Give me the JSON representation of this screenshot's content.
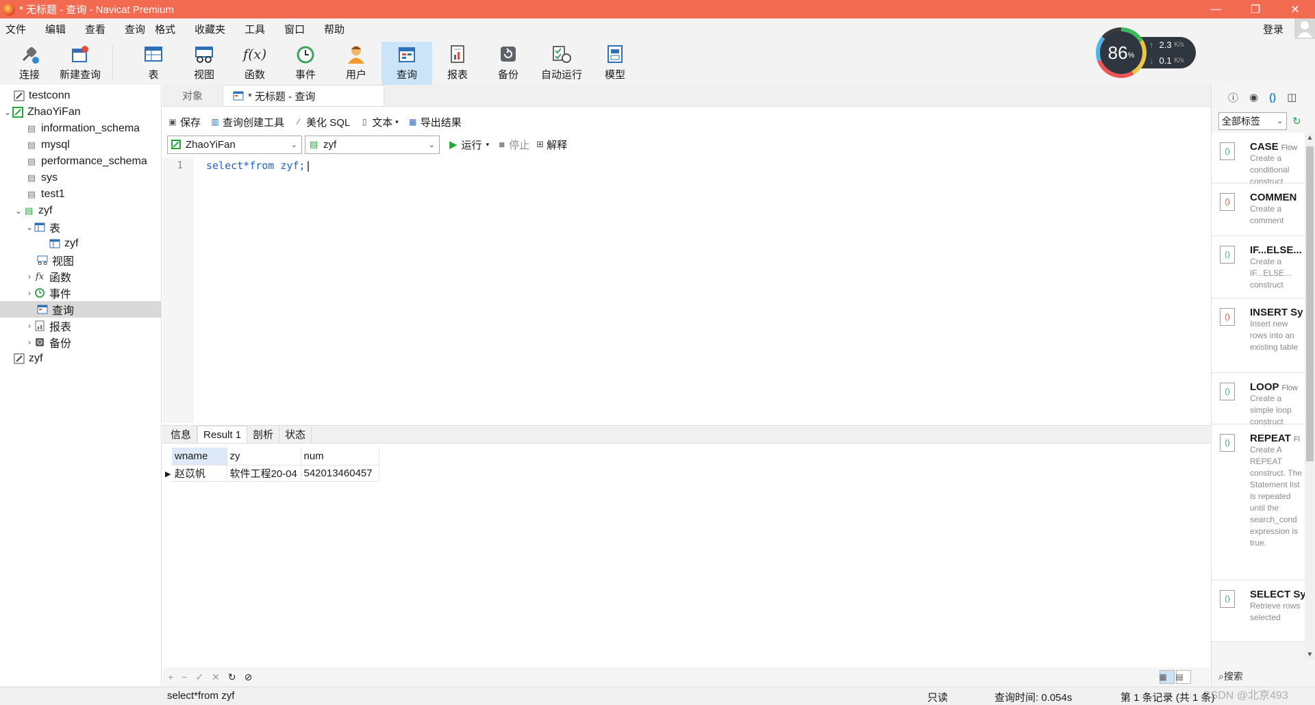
{
  "window": {
    "title": "* 无标题 - 查询 - Navicat Premium",
    "minimize": "—",
    "maximize": "❐",
    "close": "✕"
  },
  "menu": {
    "items": [
      "文件",
      "编辑",
      "查看",
      "查询",
      "格式",
      "收藏夹",
      "工具",
      "窗口",
      "帮助"
    ],
    "login": "登录"
  },
  "toolbar": {
    "connect": "连接",
    "new_query": "新建查询",
    "table": "表",
    "view": "视图",
    "function": "函数",
    "event": "事件",
    "user": "用户",
    "query": "查询",
    "report": "报表",
    "backup": "备份",
    "auto_run": "自动运行",
    "model": "模型"
  },
  "net_widget": {
    "percent": "86",
    "unit": "%",
    "up": "2.3",
    "down": "0.1",
    "rate_unit": "K/s"
  },
  "tree": {
    "items": [
      "testconn",
      "ZhaoYiFan",
      "information_schema",
      "mysql",
      "performance_schema",
      "sys",
      "test1",
      "zyf",
      "表",
      "zyf",
      "视图",
      "函数",
      "事件",
      "查询",
      "报表",
      "备份",
      "zyf"
    ]
  },
  "tabs": {
    "objects": "对象",
    "query_tab": "* 无标题 - 查询"
  },
  "query_toolbar": {
    "save": "保存",
    "builder": "查询创建工具",
    "beautify": "美化 SQL",
    "text": "文本",
    "export": "导出结果",
    "run": "运行",
    "stop": "停止",
    "explain": "解释"
  },
  "selects": {
    "connection": "ZhaoYiFan",
    "database": "zyf"
  },
  "editor": {
    "line": "1",
    "code": "select*from zyf;"
  },
  "result_tabs": [
    "信息",
    "Result 1",
    "剖析",
    "状态"
  ],
  "result": {
    "columns": [
      "wname",
      "zy",
      "num"
    ],
    "rows": [
      [
        "赵苡帆",
        "软件工程20-04",
        "542013460457"
      ]
    ]
  },
  "grid_footer": {
    "add": "+",
    "remove": "−",
    "apply": "✓",
    "discard": "✕",
    "refresh": "↻",
    "stop": "⊘"
  },
  "status": {
    "sql": "select*from zyf",
    "readonly": "只读",
    "query_time": "查询时间: 0.054s",
    "records": "第 1 条记录 (共 1 条)"
  },
  "right_panel": {
    "filter": "全部标签",
    "search": "搜索",
    "snippets": [
      {
        "name": "CASE",
        "tag": "Flow",
        "desc": "Create a conditional construct"
      },
      {
        "name": "COMMEN",
        "tag": "",
        "desc": "Create a comment"
      },
      {
        "name": "IF...ELSE...",
        "tag": "",
        "desc": "Create a IF...ELSE... construct"
      },
      {
        "name": "INSERT Sy",
        "tag": "",
        "desc": "Insert new rows into an existing table"
      },
      {
        "name": "LOOP",
        "tag": "Flow",
        "desc": "Create a simple loop construct"
      },
      {
        "name": "REPEAT",
        "tag": "Fl",
        "desc": "Create A REPEAT construct. The Statement list is repeated until the search_cond expression is true."
      },
      {
        "name": "SELECT Sy",
        "tag": "",
        "desc": "Retrieve rows selected"
      }
    ]
  },
  "watermark": "CSDN @北京493",
  "colors": {
    "titlebar": "#f26b51",
    "selection": "#cce4f7",
    "run": "#22a83a",
    "sql_keyword": "#2360c8"
  }
}
